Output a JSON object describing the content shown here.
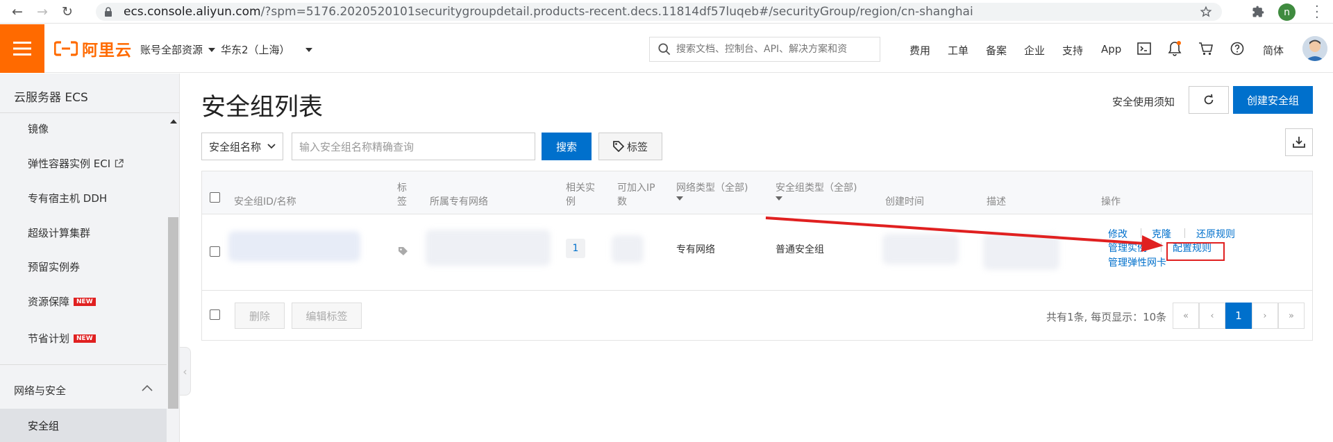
{
  "browser": {
    "url_host": "ecs.console.aliyun.com",
    "url_path": "/?spm=5176.2020520101securitygroupdetail.products-recent.decs.11814df57luqeb#/securityGroup/region/cn-shanghai",
    "profile_initial": "n"
  },
  "topbar": {
    "logo_text": "阿里云",
    "account_scope": "账号全部资源",
    "region": "华东2（上海）",
    "search_placeholder": "搜索文档、控制台、API、解决方案和资",
    "links": [
      "费用",
      "工单",
      "备案",
      "企业",
      "支持",
      "App"
    ],
    "lang": "简体"
  },
  "sidebar": {
    "title": "云服务器 ECS",
    "items": [
      {
        "label": "镜像",
        "new": false
      },
      {
        "label": "弹性容器实例 ECI",
        "new": false
      },
      {
        "label": "专有宿主机 DDH",
        "new": false
      },
      {
        "label": "超级计算集群",
        "new": false
      },
      {
        "label": "预留实例券",
        "new": false
      },
      {
        "label": "资源保障",
        "new": true
      },
      {
        "label": "节省计划",
        "new": true
      }
    ],
    "new_badge": "NEW",
    "group": "网络与安全",
    "active_item": "安全组"
  },
  "main": {
    "title": "安全组列表",
    "notice_link": "安全使用须知",
    "create_button": "创建安全组",
    "filter": {
      "field": "安全组名称",
      "placeholder": "输入安全组名称精确查询",
      "search_button": "搜索",
      "tag_button": "标签"
    },
    "table": {
      "headers": {
        "id_name": "安全组ID/名称",
        "tag_1": "标",
        "tag_2": "签",
        "vpc": "所属专有网络",
        "instances_1": "相关实",
        "instances_2": "例",
        "ips_1": "可加入IP",
        "ips_2": "数",
        "network_type": "网络类型（全部)",
        "group_type": "安全组类型（全部)",
        "created": "创建时间",
        "description": "描述",
        "actions": "操作"
      },
      "rows": [
        {
          "instances": "1",
          "network_type": "专有网络",
          "group_type": "普通安全组",
          "actions": {
            "modify": "修改",
            "clone": "克隆",
            "restore": "还原规则",
            "manage_instances": "管理实例",
            "configure_rules": "配置规则",
            "manage_eni": "管理弹性网卡"
          }
        }
      ],
      "footer": {
        "delete_button": "删除",
        "edit_tags_button": "编辑标签",
        "page_info": "共有1条, 每页显示：10条",
        "pager": {
          "first": "«",
          "prev": "‹",
          "current": "1",
          "next": "›",
          "last": "»"
        }
      }
    }
  },
  "colors": {
    "brand_orange": "#ff6a00",
    "primary_blue": "#0070cc",
    "highlight_red": "#e02020"
  }
}
